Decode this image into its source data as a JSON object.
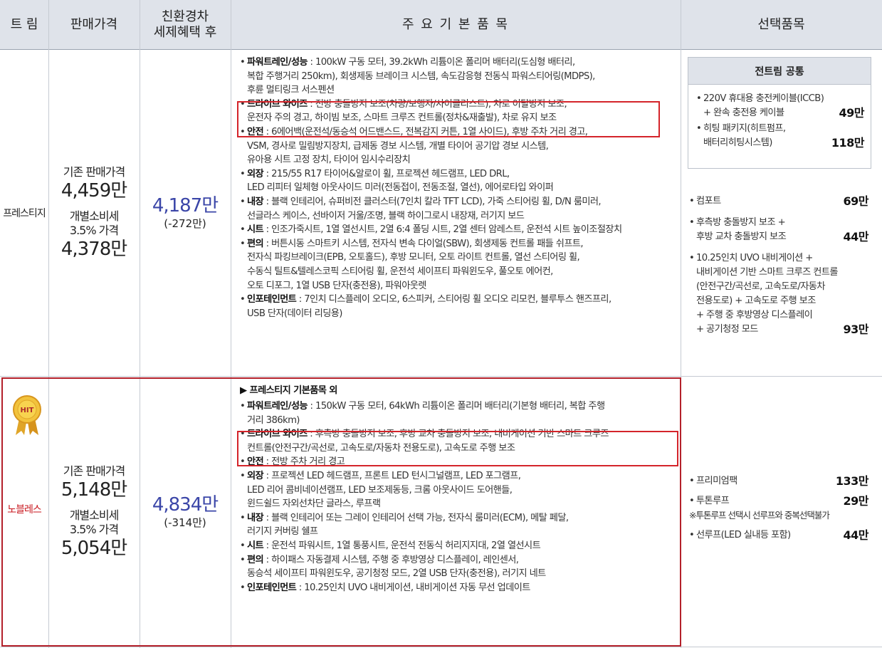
{
  "header": {
    "trim": "트 림",
    "price": "판매가격",
    "eco_line1": "친환경차",
    "eco_line2": "세제혜택 후",
    "features": "주 요 기 본 품 목",
    "options": "선택품목"
  },
  "rows": [
    {
      "trim": "프레스티지",
      "base_label": "기존 판매가격",
      "base_price": "4,459만",
      "tax_label1": "개별소비세",
      "tax_label2": "3.5% 가격",
      "tax_price": "4,378만",
      "eco_price": "4,187만",
      "eco_diff": "(-272만)"
    },
    {
      "trim": "노블레스",
      "badge": "HIT",
      "base_label": "기존 판매가격",
      "base_price": "5,148만",
      "tax_label1": "개별소비세",
      "tax_label2": "3.5% 가격",
      "tax_price": "5,054만",
      "eco_price": "4,834만",
      "eco_diff": "(-314만)"
    }
  ],
  "features_prestige": [
    {
      "title": "파워트레인/성능",
      "lines": [
        " : 100kW 구동 모터, 39.2kWh 리튬이온 폴리머 배터리(도심형 배터리,",
        "복합 주행거리 250km), 회생제동 브레이크 시스템, 속도감응형 전동식 파워스티어링(MDPS),",
        "후륜 멀티링크 서스펜션"
      ]
    },
    {
      "title": "드라이브 와이즈",
      "lines": [
        " : 전방 충돌방지 보조(차량/보행자/사이클리스트), 차로 이탈방지 보조,",
        "운전자 주의 경고, 하이빔 보조, 스마트 크루즈 컨트롤(정차&재출발), 차로 유지 보조"
      ]
    },
    {
      "title": "안전",
      "lines": [
        " : 6에어백(운전석/동승석 어드밴스드, 전복감지 커튼, 1열 사이드), 후방 주차 거리 경고,",
        "VSM, 경사로 밀림방지장치, 급제동 경보 시스템, 개별 타이어 공기압 경보 시스템,",
        "유아용 시트 고정 장치, 타이어 임시수리장치"
      ]
    },
    {
      "title": "외장",
      "lines": [
        " : 215/55 R17 타이어&알로이 휠, 프로젝션 헤드램프, LED DRL,",
        "LED 리피터 일체형 아웃사이드 미러(전동접이, 전동조절, 열선), 에어로타입 와이퍼"
      ]
    },
    {
      "title": "내장",
      "lines": [
        " : 블랙 인테리어, 슈퍼비전 클러스터(7인치 칼라 TFT LCD), 가죽 스티어링 휠, D/N 룸미러,",
        "선글라스 케이스, 선바이저 거울/조명, 블랙 하이그로시 내장재, 러기지 보드"
      ]
    },
    {
      "title": "시트",
      "lines": [
        " : 인조가죽시트, 1열 열선시트, 2열 6:4 폴딩 시트, 2열 센터 암레스트, 운전석 시트 높이조절장치"
      ]
    },
    {
      "title": "편의",
      "lines": [
        " : 버튼시동 스마트키 시스템, 전자식 변속 다이얼(SBW), 회생제동 컨트롤 패들 쉬프트,",
        "전자식 파킹브레이크(EPB, 오토홀드), 후방 모니터, 오토 라이트 컨트롤, 열선 스티어링 휠,",
        "수동식 틸트&텔레스코픽 스티어링 휠, 운전석 세이프티 파워윈도우, 풀오토 에어컨,",
        "오토 디포그, 1열 USB 단자(충전용), 파워아웃렛"
      ]
    },
    {
      "title": "인포테인먼트",
      "lines": [
        " : 7인치 디스플레이 오디오, 6스피커, 스티어링 휠 오디오 리모컨, 블루투스 핸즈프리,",
        "USB 단자(데이터 리딩용)"
      ]
    }
  ],
  "features_noblesse_intro": "▶ 프레스티지 기본품목 외",
  "features_noblesse": [
    {
      "title": "파워트레인/성능",
      "lines": [
        " : 150kW 구동 모터, 64kWh 리튬이온 폴리머 배터리(기본형 배터리, 복합 주행",
        "거리 386km)"
      ]
    },
    {
      "title": "드라이브 와이즈",
      "lines": [
        " : 후측방 충돌방지 보조, 후방 교차 충돌방지 보조, 내비게이션 기반 스마트 크루즈",
        "컨트롤(안전구간/곡선로, 고속도로/자동차 전용도로), 고속도로 주행 보조"
      ]
    },
    {
      "title": "안전",
      "lines": [
        " : 전방 주차 거리 경고"
      ]
    },
    {
      "title": "외장",
      "lines": [
        " : 프로젝션 LED 헤드램프, 프론트 LED 턴시그널램프, LED 포그램프,",
        "LED 리어 콤비네이션램프, LED 보조제동등, 크롬 아웃사이드 도어핸들,",
        "윈드쉴드 자외선차단 글라스, 루프랙"
      ]
    },
    {
      "title": "내장",
      "lines": [
        " : 블랙 인테리어 또는 그레이 인테리어 선택 가능, 전자식 룸미러(ECM), 메탈 페달,",
        "러기지 커버링 쉘프"
      ]
    },
    {
      "title": "시트",
      "lines": [
        " : 운전석 파워시트, 1열 통풍시트, 운전석 전동식 허리지지대, 2열 열선시트"
      ]
    },
    {
      "title": "편의",
      "lines": [
        " : 하이패스 자동결제 시스템, 주행 중 후방영상 디스플레이, 레인센서,",
        "동승석 세이프티 파워윈도우, 공기청정 모드, 2열 USB 단자(충전용), 러기지 네트"
      ]
    },
    {
      "title": "인포테인먼트",
      "lines": [
        " : 10.25인치 UVO 내비게이션, 내비게이션 자동 무선 업데이트"
      ]
    }
  ],
  "options_common": {
    "title": "전트림 공통",
    "items": [
      {
        "lines": [
          "220V 휴대용 충전케이블(ICCB)",
          "+ 완속 충전용 케이블"
        ],
        "price": "49만"
      },
      {
        "lines": [
          "히팅 패키지(히트펌프,",
          "배터리히팅시스템)"
        ],
        "price": "118만"
      }
    ]
  },
  "options_prestige": [
    {
      "lines": [
        "컴포트"
      ],
      "price": "69만"
    },
    {
      "lines": [
        "후측방 충돌방지 보조 +",
        "후방 교차 충돌방지 보조"
      ],
      "price": "44만"
    },
    {
      "lines": [
        "10.25인치 UVO 내비게이션 +",
        "내비게이션 기반 스마트 크루즈 컨트롤",
        "(안전구간/곡선로, 고속도로/자동차",
        "전용도로) + 고속도로 주행 보조",
        "+ 주행 중 후방영상 디스플레이",
        "+ 공기청정 모드"
      ],
      "price": "93만"
    }
  ],
  "options_noblesse": [
    {
      "lines": [
        "프리미엄팩"
      ],
      "price": "133만"
    },
    {
      "lines": [
        "투톤루프"
      ],
      "price": "29만",
      "note": "※투톤루프 선택시 선루프와 중복선택불가"
    },
    {
      "lines": [
        "선루프(LED 실내등 포함)"
      ],
      "price": "44만"
    }
  ],
  "colors": {
    "header_bg": "#dfe3ea",
    "accent_blue": "#3b46a8",
    "highlight_red": "#d4242a",
    "trim_red": "#c8161d"
  }
}
